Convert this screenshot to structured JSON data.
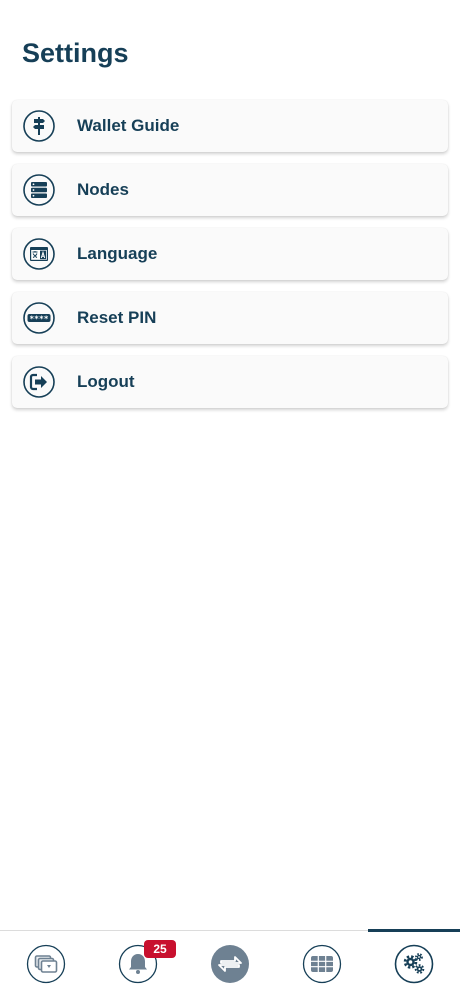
{
  "header": {
    "title": "Settings"
  },
  "menu": {
    "items": [
      {
        "label": "Wallet Guide",
        "icon": "signpost-icon"
      },
      {
        "label": "Nodes",
        "icon": "server-icon"
      },
      {
        "label": "Language",
        "icon": "translate-icon"
      },
      {
        "label": "Reset PIN",
        "icon": "pin-keypad-icon"
      },
      {
        "label": "Logout",
        "icon": "logout-icon"
      }
    ]
  },
  "tabbar": {
    "tabs": [
      {
        "name": "wallet",
        "icon": "wallet-cards-icon"
      },
      {
        "name": "notifications",
        "icon": "bell-icon",
        "badge": "25"
      },
      {
        "name": "transfer",
        "icon": "swap-arrows-icon"
      },
      {
        "name": "apps",
        "icon": "grid-icon"
      },
      {
        "name": "settings",
        "icon": "gears-icon",
        "active": true
      }
    ]
  },
  "colors": {
    "primary": "#163f57",
    "badge": "#c8102e",
    "transfer_bg": "#6e8192",
    "card_bg": "#fafafa"
  }
}
